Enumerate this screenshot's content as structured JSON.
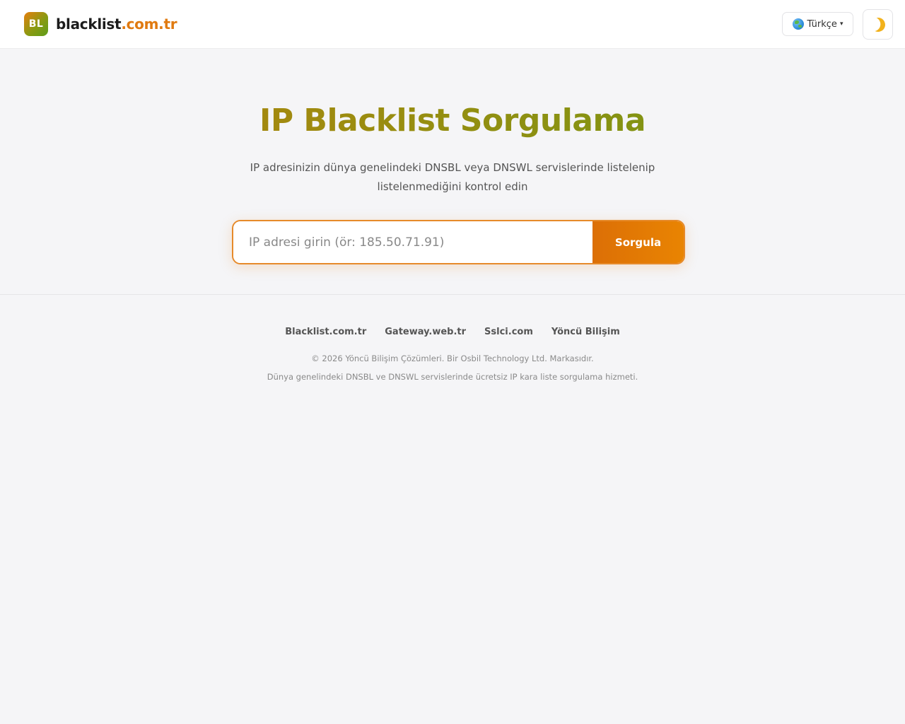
{
  "header": {
    "logo_badge": "BL",
    "logo_name": "blacklist",
    "logo_tld": ".com.tr",
    "language_label": "Türkçe",
    "language_caret": "▾",
    "theme_icon": "moon-icon"
  },
  "hero": {
    "title": "IP Blacklist Sorgulama",
    "subtitle": "IP adresinizin dünya genelindeki DNSBL veya DNSWL servislerinde listelenip listelenmediğini kontrol edin"
  },
  "search": {
    "placeholder": "IP adresi girin (ör: 185.50.71.91)",
    "value": "",
    "button_label": "Sorgula"
  },
  "footer": {
    "links": [
      "Blacklist.com.tr",
      "Gateway.web.tr",
      "Sslci.com",
      "Yöncü Bilişim"
    ],
    "copyright": "© 2026 Yöncü Bilişim Çözümleri. Bir Osbil Technology Ltd. Markasıdır.",
    "description": "Dünya genelindeki DNSBL ve DNSWL servislerinde ücretsiz IP kara liste sorgulama hizmeti."
  },
  "colors": {
    "accent": "#e07a10",
    "title_gradient_start": "#b7810c",
    "title_gradient_end": "#6e9a16",
    "background": "#f5f5f7"
  }
}
